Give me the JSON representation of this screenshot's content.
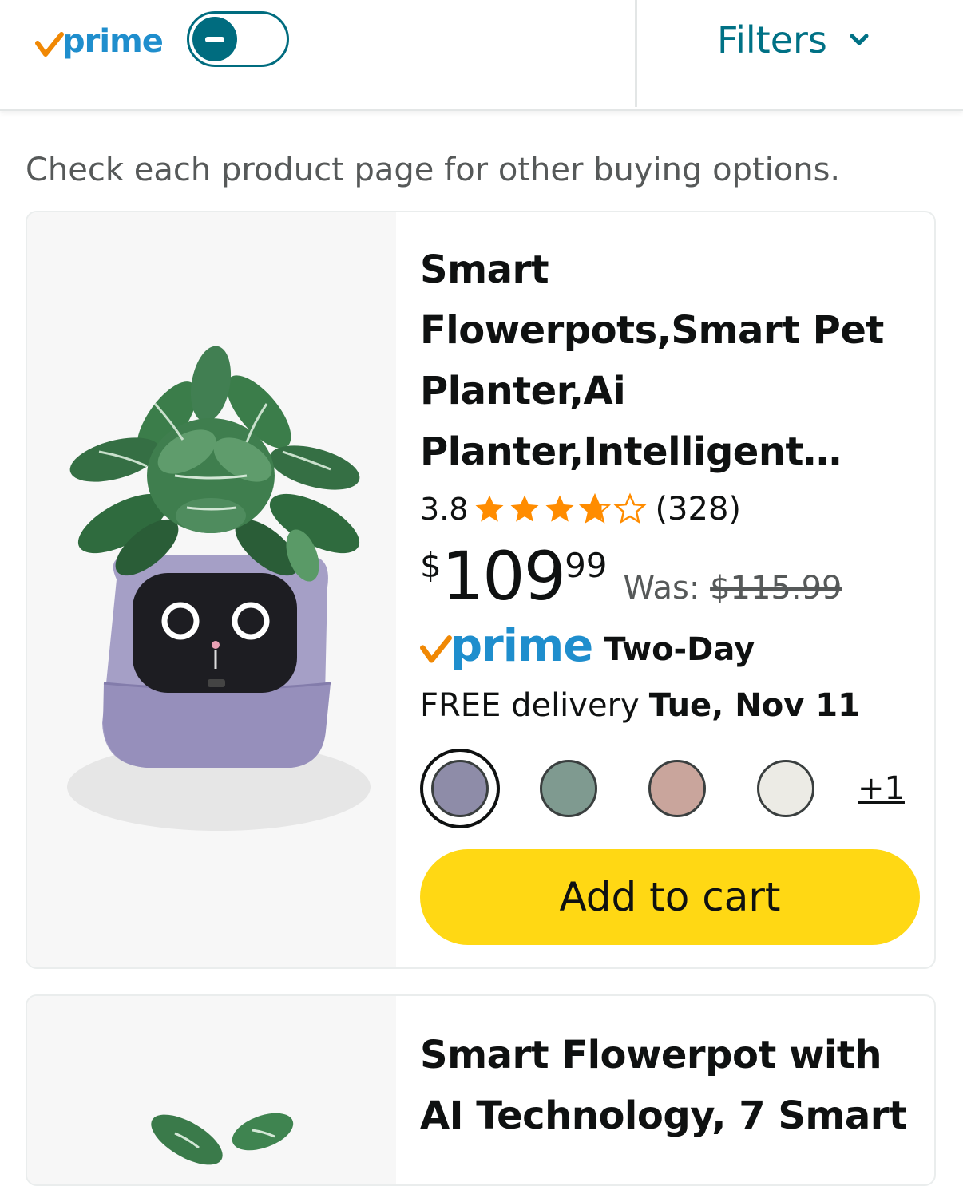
{
  "header": {
    "prime_label": "prime",
    "prime_toggle_state": "off",
    "filters_label": "Filters"
  },
  "notice": "Check each product page for other buying options.",
  "products": [
    {
      "title": "Smart Flowerpots,Smart Pet Planter,Ai Planter,Intelligent…",
      "rating": "3.8",
      "rating_value": 3.8,
      "rating_count": "(328)",
      "price_symbol": "$",
      "price_whole": "109",
      "price_fraction": "99",
      "was_label": "Was:",
      "was_price": "$115.99",
      "prime_label": "prime",
      "shipping_speed": "Two-Day",
      "delivery_label": "FREE delivery",
      "delivery_date": "Tue, Nov 11",
      "color_options": [
        {
          "color": "#8e8ca8",
          "selected": true
        },
        {
          "color": "#7f9a90",
          "selected": false
        },
        {
          "color": "#c9a59c",
          "selected": false
        },
        {
          "color": "#ecebe5",
          "selected": false
        }
      ],
      "more_colors": "+1",
      "add_to_cart": "Add to cart",
      "image": "plant-pot-icon"
    },
    {
      "title": "Smart Flowerpot with AI Technology, 7 Smart",
      "image": "plant-icon"
    }
  ],
  "colors": {
    "accent_teal": "#007185",
    "toggle_teal": "#006c7f",
    "prime_blue": "#1f8ecd",
    "prime_orange": "#f08804",
    "star_orange": "#ff8c00",
    "cart_yellow": "#ffd814"
  }
}
